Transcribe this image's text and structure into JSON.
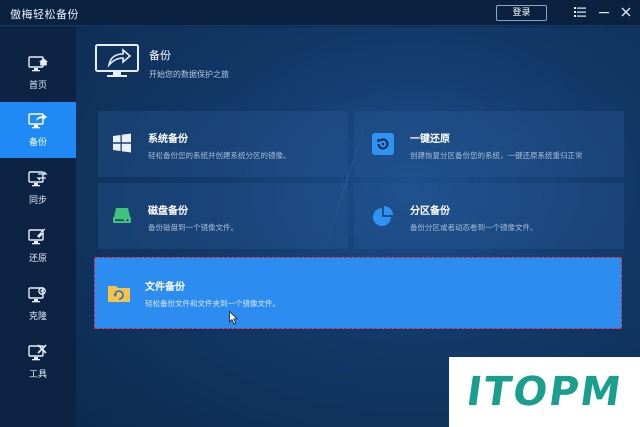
{
  "window": {
    "title": "傲梅轻松备份"
  },
  "titlebar": {
    "login_label": "登录",
    "icons": [
      "menu-icon",
      "minimize-icon",
      "close-icon"
    ]
  },
  "sidebar": {
    "items": [
      {
        "label": "首页",
        "icon": "home-monitor-icon",
        "active": false
      },
      {
        "label": "备份",
        "icon": "backup-monitor-icon",
        "active": true
      },
      {
        "label": "同步",
        "icon": "sync-monitor-icon",
        "active": false
      },
      {
        "label": "还原",
        "icon": "restore-monitor-icon",
        "active": false
      },
      {
        "label": "克隆",
        "icon": "clone-monitor-icon",
        "active": false
      },
      {
        "label": "工具",
        "icon": "tools-monitor-icon",
        "active": false
      }
    ]
  },
  "header": {
    "title": "备份",
    "subtitle": "开始您的数据保护之旅"
  },
  "cards": [
    {
      "title": "系统备份",
      "desc": "轻松备份您的系统并创建系统分区的镜像。",
      "icon": "windows-icon"
    },
    {
      "title": "一键还原",
      "desc": "创建恢复分区备份您的系统，一键还原系统重归正常",
      "icon": "restore-icon"
    },
    {
      "title": "磁盘备份",
      "desc": "备份磁盘到一个镜像文件。",
      "icon": "disk-icon"
    },
    {
      "title": "分区备份",
      "desc": "备份分区或者动态卷到一个镜像文件。",
      "icon": "pie-chart-icon"
    },
    {
      "title": "文件备份",
      "desc": "轻松备份文件和文件夹到一个镜像文件。",
      "icon": "folder-sync-icon",
      "selected": true
    }
  ],
  "watermark": {
    "text": "ITOPM"
  },
  "colors": {
    "accent": "#1f8af5",
    "selected_card": "#2d8cf0",
    "selection_border": "#d8202c",
    "watermark": "#1a9e8e"
  }
}
